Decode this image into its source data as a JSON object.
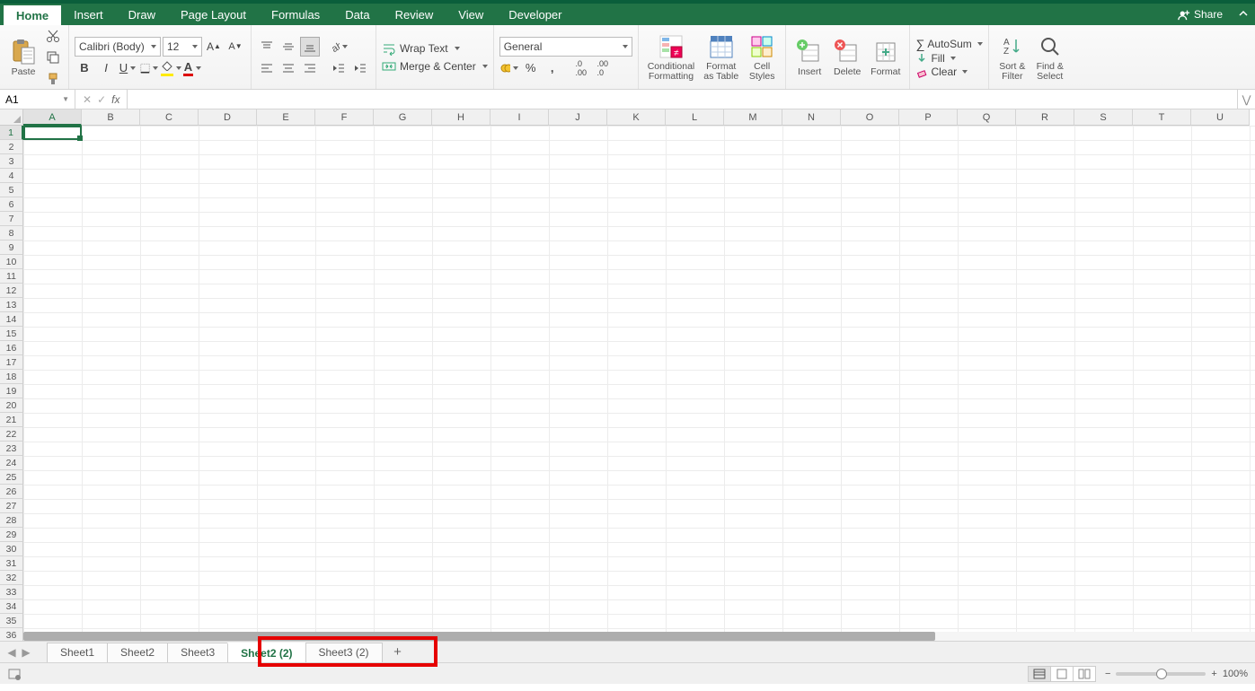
{
  "menu": {
    "tabs": [
      "Home",
      "Insert",
      "Draw",
      "Page Layout",
      "Formulas",
      "Data",
      "Review",
      "View",
      "Developer"
    ],
    "active": "Home",
    "share": "Share"
  },
  "ribbon": {
    "paste": "Paste",
    "font_name": "Calibri (Body)",
    "font_size": "12",
    "wrap": "Wrap Text",
    "merge": "Merge & Center",
    "number_format": "General",
    "cond_fmt": "Conditional\nFormatting",
    "fmt_table": "Format\nas Table",
    "cell_styles": "Cell\nStyles",
    "insert": "Insert",
    "delete": "Delete",
    "format": "Format",
    "autosum": "AutoSum",
    "fill": "Fill",
    "clear": "Clear",
    "sortfilter": "Sort &\nFilter",
    "findselect": "Find &\nSelect"
  },
  "formula_bar": {
    "name_box": "A1",
    "formula": ""
  },
  "grid": {
    "columns": [
      "A",
      "B",
      "C",
      "D",
      "E",
      "F",
      "G",
      "H",
      "I",
      "J",
      "K",
      "L",
      "M",
      "N",
      "O",
      "P",
      "Q",
      "R",
      "S",
      "T",
      "U"
    ],
    "rows": 36,
    "selected_cell": "A1"
  },
  "sheets": {
    "tabs": [
      "Sheet1",
      "Sheet2",
      "Sheet3",
      "Sheet2 (2)",
      "Sheet3 (2)"
    ],
    "active": "Sheet2 (2)"
  },
  "status": {
    "zoom": "100%"
  }
}
